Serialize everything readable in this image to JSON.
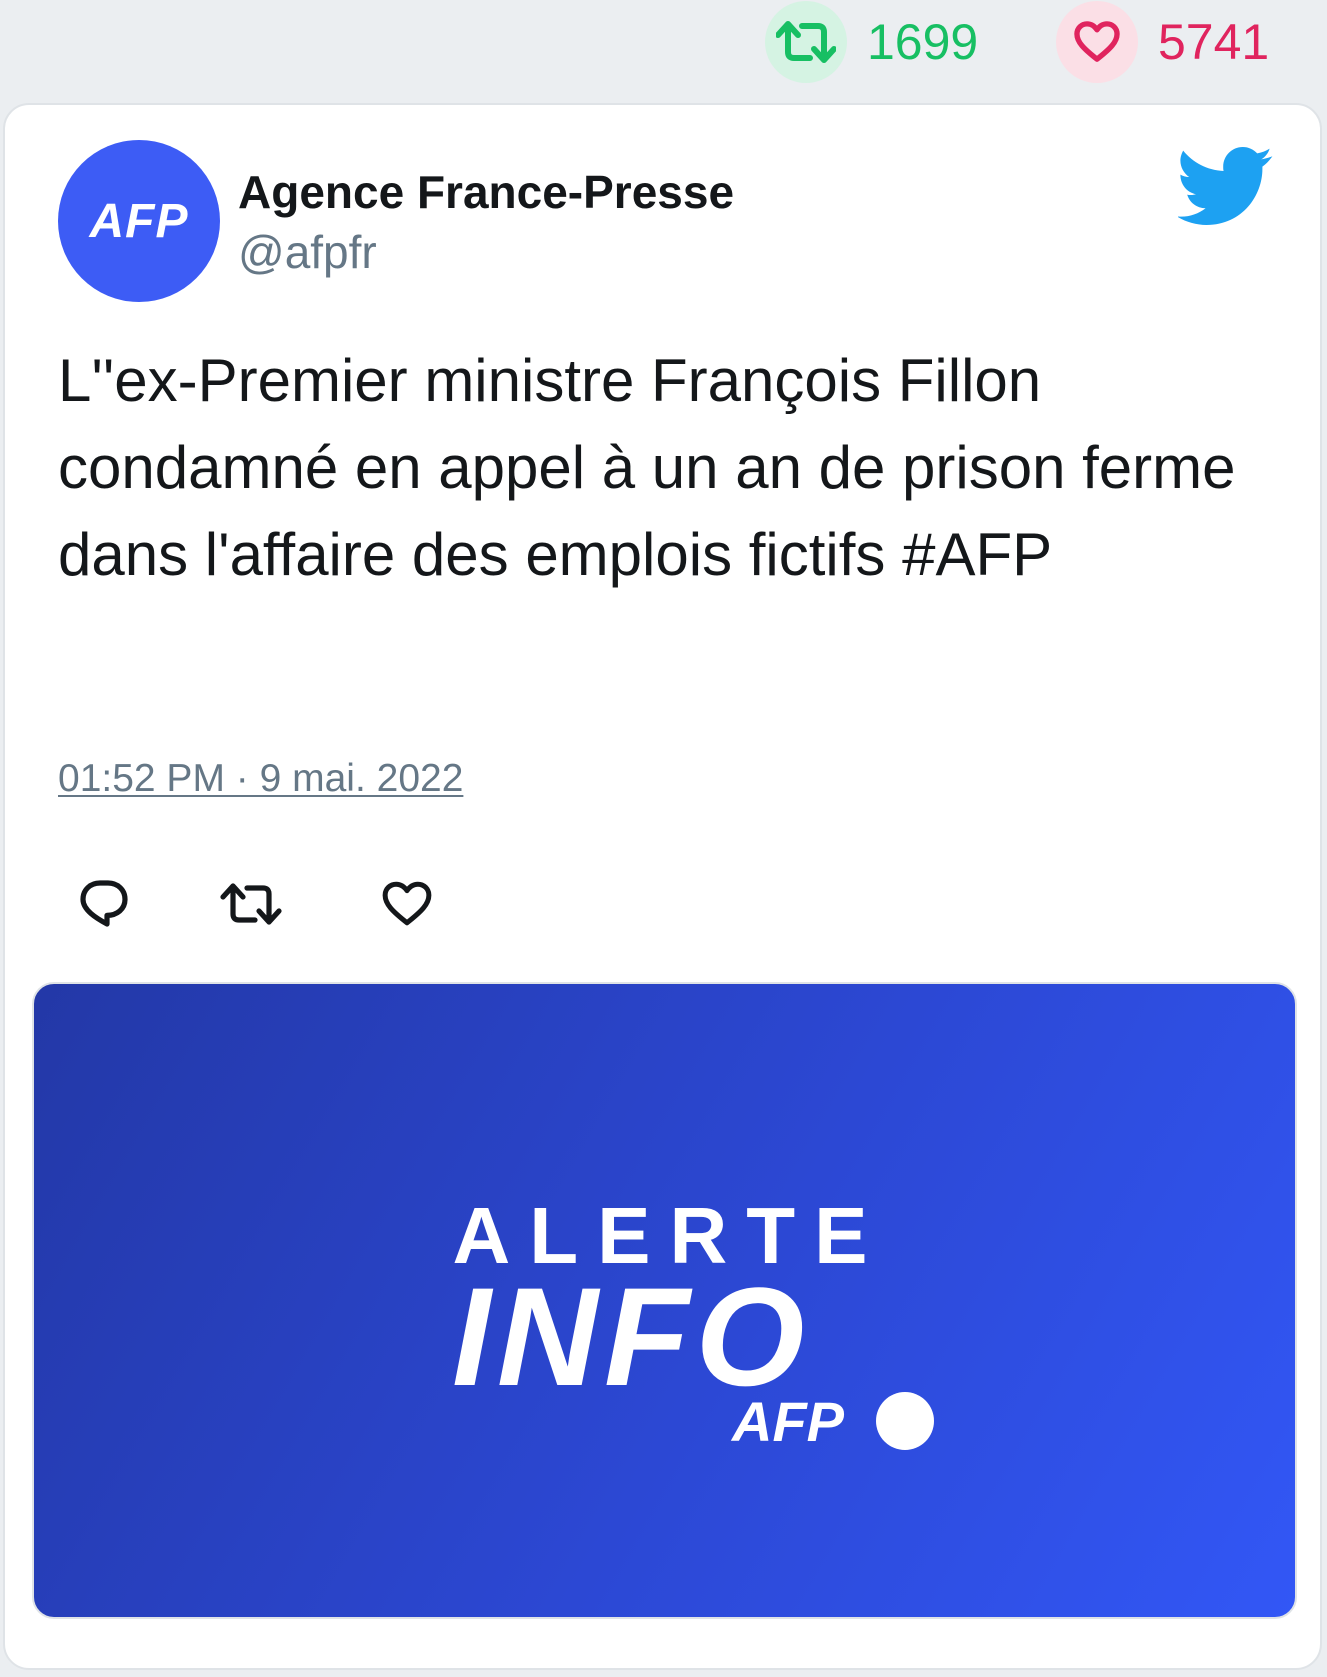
{
  "stats": {
    "retweet_count": "1699",
    "like_count": "5741"
  },
  "author": {
    "avatar_text": "AFP",
    "name": "Agence France-Presse",
    "handle": "@afpfr"
  },
  "tweet": {
    "text": "L''ex-Premier ministre François Fillon condamné en appel à un an de prison ferme dans l'affaire des emplois fictifs #AFP",
    "timestamp": "01:52 PM · 9 mai. 2022"
  },
  "media": {
    "line1": "ALERTE",
    "line2": "INFO",
    "brand": "AFP"
  },
  "colors": {
    "retweet_green": "#17bf63",
    "like_red": "#e0245e",
    "twitter_blue": "#1da1f2",
    "afp_blue": "#3d5cf5",
    "muted_gray": "#657786"
  },
  "icons": {
    "retweet": "retweet-icon",
    "like": "heart-icon",
    "reply": "reply-icon",
    "brand": "twitter-bird-icon"
  }
}
